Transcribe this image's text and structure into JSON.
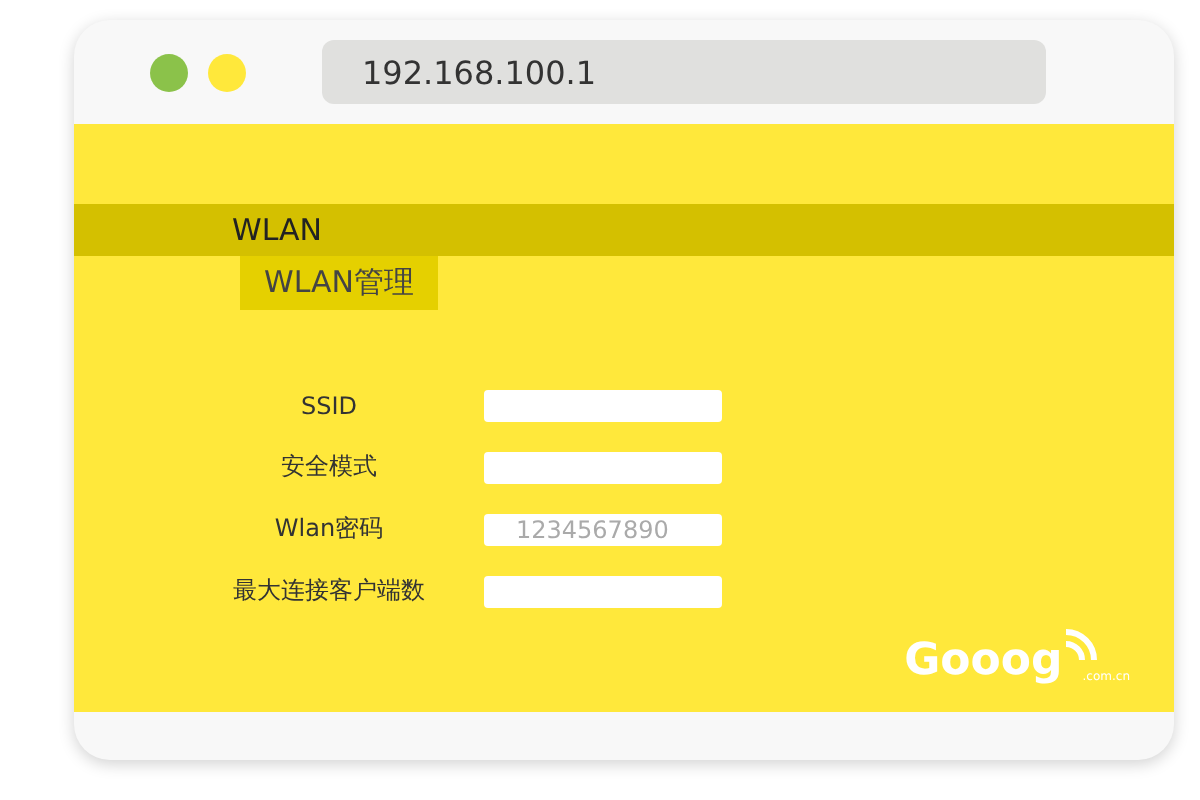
{
  "window": {
    "address": "192.168.100.1"
  },
  "menu": {
    "label": "WLAN",
    "children": [
      {
        "label": "WLAN管理",
        "selected": true
      }
    ]
  },
  "form": [
    {
      "label": "SSID"
    },
    {
      "label": "安全模式"
    },
    {
      "label": "Wlan密码",
      "placeholder": "1234567890"
    },
    {
      "label": "最大连接客户端数"
    }
  ],
  "logo": {
    "name": "Gooog",
    "domain": ".com.cn"
  }
}
